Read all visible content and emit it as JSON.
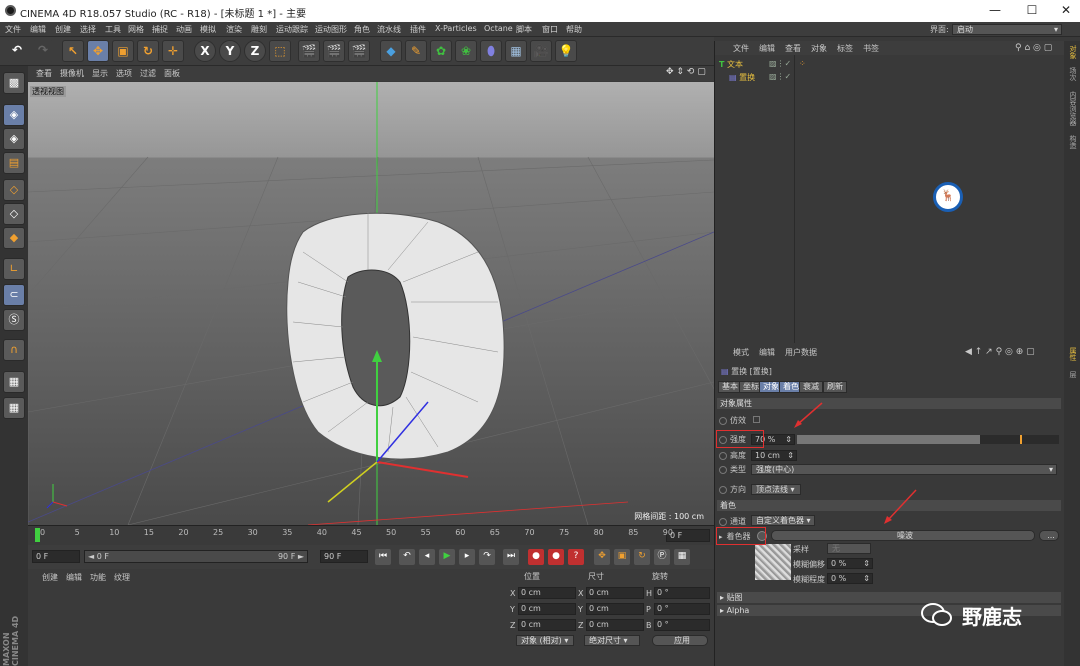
{
  "window": {
    "title": "CINEMA 4D R18.057 Studio (RC - R18) - [未标题 1 *] - 主要",
    "min": "—",
    "max": "☐",
    "close": "✕"
  },
  "menubar": {
    "items": [
      "文件",
      "编辑",
      "创建",
      "选择",
      "工具",
      "网格",
      "捕捉",
      "动画",
      "模拟",
      "渲染",
      "雕刻",
      "运动跟踪",
      "运动图形",
      "角色",
      "流水线",
      "插件",
      "X-Particles",
      "Octane",
      "脚本",
      "窗口",
      "帮助"
    ],
    "layout_label": "界面:",
    "layout_value": "启动"
  },
  "toolbar": {
    "x": "X",
    "y": "Y",
    "z": "Z"
  },
  "viewport": {
    "menu": [
      "查看",
      "摄像机",
      "显示",
      "选项",
      "过滤",
      "面板"
    ],
    "label": "透视视图",
    "grid_size": "网格间距 : 100 cm"
  },
  "timeline": {
    "ticks": [
      "0",
      "5",
      "10",
      "15",
      "20",
      "25",
      "30",
      "35",
      "40",
      "45",
      "50",
      "55",
      "60",
      "65",
      "70",
      "75",
      "80",
      "85",
      "90"
    ],
    "end_frame": "0 F"
  },
  "playbar": {
    "start": "0 F",
    "range_start": "◄ 0 F",
    "range_end": "90 F ►",
    "end": "90 F"
  },
  "material_panel": {
    "menu": [
      "创建",
      "编辑",
      "功能",
      "纹理"
    ]
  },
  "coords": {
    "headers": [
      "位置",
      "尺寸",
      "旋转"
    ],
    "rows": [
      {
        "a": "X",
        "pos": "0 cm",
        "b": "X",
        "size": "0 cm",
        "c": "H",
        "rot": "0 °"
      },
      {
        "a": "Y",
        "pos": "0 cm",
        "b": "Y",
        "size": "0 cm",
        "c": "P",
        "rot": "0 °"
      },
      {
        "a": "Z",
        "pos": "0 cm",
        "b": "Z",
        "size": "0 cm",
        "c": "B",
        "rot": "0 °"
      }
    ],
    "mode": "对象 (相对)",
    "size_mode": "绝对尺寸",
    "apply": "应用"
  },
  "object_manager": {
    "menu": [
      "文件",
      "编辑",
      "查看",
      "对象",
      "标签",
      "书签"
    ],
    "objects": [
      {
        "name": "文本",
        "color": "#e8c040"
      },
      {
        "name": "置换",
        "color": "#e8c040"
      }
    ],
    "logo_text": "野鹿志"
  },
  "side_tabs": [
    "对象",
    "场次",
    "内容浏览器",
    "构造"
  ],
  "side_tabs_bottom": [
    "属性",
    "层"
  ],
  "attributes": {
    "menu": [
      "模式",
      "编辑",
      "用户数据"
    ],
    "object_title": "置换 [置换]",
    "tabs": [
      {
        "label": "基本",
        "on": false
      },
      {
        "label": "坐标",
        "on": false
      },
      {
        "label": "对象",
        "on": true
      },
      {
        "label": "着色",
        "on": true
      },
      {
        "label": "衰减",
        "on": false
      },
      {
        "label": "刷新",
        "on": false
      }
    ],
    "section_object": "对象属性",
    "imitate": "仿效",
    "strength_label": "强度",
    "strength_value": "70 %",
    "strength_fraction": 0.7,
    "height_label": "高度",
    "height_value": "10 cm",
    "type_label": "类型",
    "type_value": "强度(中心)",
    "direction_label": "方向",
    "direction_value": "顶点法线",
    "section_shading": "着色",
    "channel_label": "通道",
    "channel_value": "自定义着色器",
    "shader_label": "着色器",
    "shader_value": "噪波",
    "sampling_label": "采样",
    "sampling_value": "无",
    "blur_offset_label": "模糊偏移",
    "blur_offset_value": "0 %",
    "blur_scale_label": "模糊程度",
    "blur_scale_value": "0 %",
    "map_label": "贴图",
    "alpha_label": "Alpha",
    "more": "..."
  },
  "watermark": {
    "text": "野鹿志"
  },
  "colors": {
    "accent_blue": "#6a7fa8",
    "annotation_red": "#e03030",
    "axis_y": "#40d040",
    "axis_x": "#e03030"
  }
}
